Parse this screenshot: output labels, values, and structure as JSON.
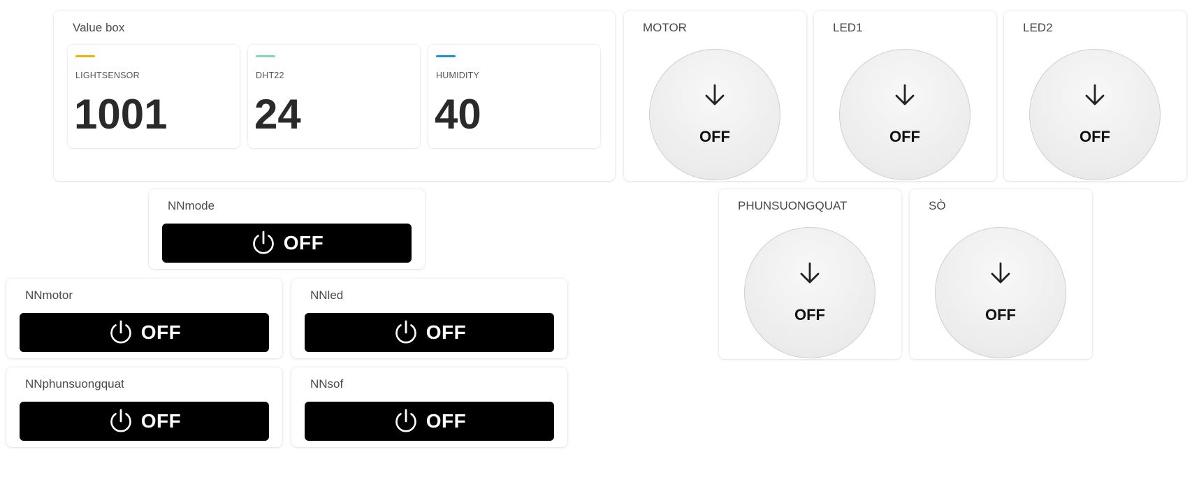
{
  "value_box": {
    "title": "Value box",
    "items": [
      {
        "label": "LIGHTSENSOR",
        "value": "1001",
        "color": "#f0b400"
      },
      {
        "label": "DHT22",
        "value": "24",
        "color": "#7fd8b8"
      },
      {
        "label": "HUMIDITY",
        "value": "40",
        "color": "#1e90d8"
      }
    ]
  },
  "round_widgets": {
    "motor": {
      "title": "MOTOR",
      "state": "OFF"
    },
    "led1": {
      "title": "LED1",
      "state": "OFF"
    },
    "led2": {
      "title": "LED2",
      "state": "OFF"
    },
    "phunsuongquat": {
      "title": "PHUNSUONGQUAT",
      "state": "OFF"
    },
    "so": {
      "title": "SÒ",
      "state": "OFF"
    }
  },
  "switch_widgets": {
    "nnmode": {
      "title": "NNmode",
      "state": "OFF"
    },
    "nnmotor": {
      "title": "NNmotor",
      "state": "OFF"
    },
    "nnled": {
      "title": "NNled",
      "state": "OFF"
    },
    "nnphunsuongquat": {
      "title": "NNphunsuongquat",
      "state": "OFF"
    },
    "nnsof": {
      "title": "NNsof",
      "state": "OFF"
    }
  },
  "icons": {
    "round_button": "arrow-down-icon",
    "switch_button": "power-icon"
  }
}
